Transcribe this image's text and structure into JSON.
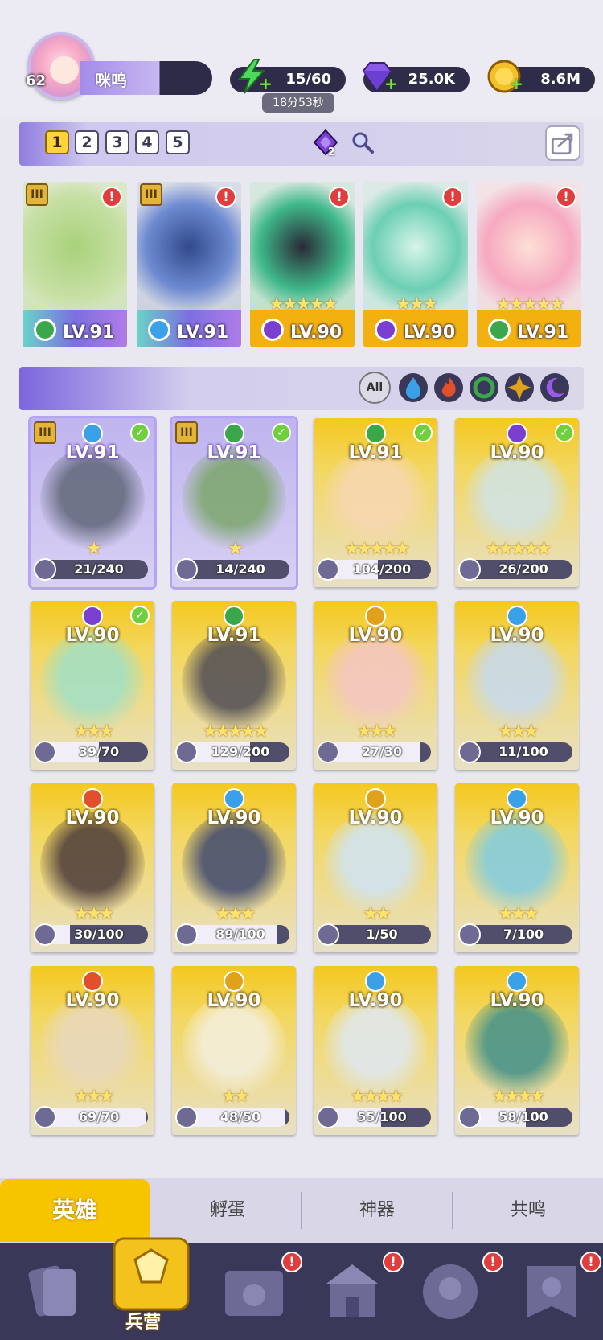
{
  "player": {
    "level": "62",
    "name": "咪呜"
  },
  "resources": {
    "energy": "15/60",
    "energy_timer": "18分53秒",
    "gems": "25.0K",
    "coins": "8.6M"
  },
  "teams": {
    "tabs": [
      "1",
      "2",
      "3",
      "4",
      "5"
    ],
    "active": "1",
    "gem_count": "2"
  },
  "team_slots": [
    {
      "level": "LV.91",
      "element_color": "#3aa84a",
      "rank": "III"
    },
    {
      "level": "LV.91",
      "element_color": "#3aa1e8",
      "rank": "III"
    },
    {
      "level": "LV.90",
      "element_color": "#7a3fd1"
    },
    {
      "level": "LV.90",
      "element_color": "#7a3fd1"
    },
    {
      "level": "LV.91",
      "element_color": "#3aa84a"
    }
  ],
  "filter": {
    "all_label": "All"
  },
  "heroes": [
    {
      "level": "LV.91",
      "progress": "21/240",
      "stars": "★",
      "element_color": "#3aa1e8",
      "selected": true,
      "checked": true
    },
    {
      "level": "LV.91",
      "progress": "14/240",
      "stars": "★",
      "element_color": "#3aa84a",
      "selected": true,
      "checked": true
    },
    {
      "level": "LV.91",
      "progress": "104/200",
      "stars": "★★★★★",
      "element_color": "#3aa84a",
      "checked": true
    },
    {
      "level": "LV.90",
      "progress": "26/200",
      "stars": "★★★★★",
      "element_color": "#7a3fd1",
      "checked": true
    },
    {
      "level": "LV.90",
      "progress": "39/70",
      "stars": "★★★",
      "element_color": "#7a3fd1",
      "checked": true
    },
    {
      "level": "LV.91",
      "progress": "129/200",
      "stars": "★★★★★",
      "element_color": "#3aa84a"
    },
    {
      "level": "LV.90",
      "progress": "27/30",
      "stars": "★★★",
      "element_color": "#e0a21a"
    },
    {
      "level": "LV.90",
      "progress": "11/100",
      "stars": "★★★",
      "element_color": "#3aa1e8"
    },
    {
      "level": "LV.90",
      "progress": "30/100",
      "stars": "★★★",
      "element_color": "#e2502b"
    },
    {
      "level": "LV.90",
      "progress": "89/100",
      "stars": "★★★",
      "element_color": "#3aa1e8"
    },
    {
      "level": "LV.90",
      "progress": "1/50",
      "stars": "★★",
      "element_color": "#e0a21a"
    },
    {
      "level": "LV.90",
      "progress": "7/100",
      "stars": "★★★",
      "element_color": "#3aa1e8"
    },
    {
      "level": "LV.90",
      "progress": "69/70",
      "stars": "★★★",
      "element_color": "#e2502b"
    },
    {
      "level": "LV.90",
      "progress": "48/50",
      "stars": "★★",
      "element_color": "#e0a21a"
    },
    {
      "level": "LV.90",
      "progress": "55/100",
      "stars": "★★★★",
      "element_color": "#3aa1e8"
    },
    {
      "level": "LV.90",
      "progress": "58/100",
      "stars": "★★★★",
      "element_color": "#3aa1e8"
    }
  ],
  "sub_tabs": [
    "英雄",
    "孵蛋",
    "神器",
    "共鸣"
  ],
  "nav": {
    "active_label": "兵营"
  }
}
